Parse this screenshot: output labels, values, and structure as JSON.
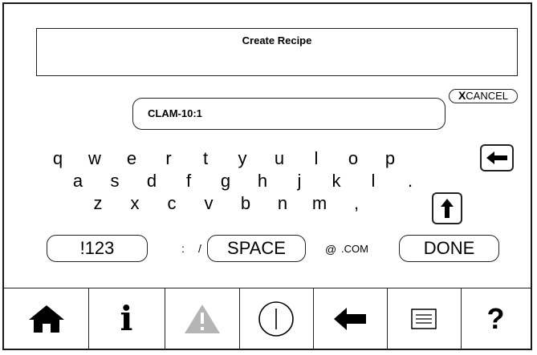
{
  "header": {
    "title": "Create Recipe"
  },
  "cancel_button": {
    "x_label": "X",
    "label": "CANCEL"
  },
  "input": {
    "value": "CLAM-10:1"
  },
  "keyboard": {
    "row1": [
      "q",
      "w",
      "e",
      "r",
      "t",
      "y",
      "u",
      "l",
      "o",
      "p"
    ],
    "row2": [
      "a",
      "s",
      "d",
      "f",
      "g",
      "h",
      "j",
      "k",
      "l",
      "."
    ],
    "row3": [
      "z",
      "x",
      "c",
      "v",
      "b",
      "n",
      "m",
      ","
    ],
    "symbols_label": "!123",
    "colon_label": ":",
    "slash_label": "/",
    "space_label": "SPACE",
    "at_label": "@",
    "com_label": ".COM",
    "done_label": "DONE"
  },
  "toolbar": {
    "items": [
      {
        "icon": "home-icon"
      },
      {
        "icon": "info-icon",
        "label": "i"
      },
      {
        "icon": "warning-icon",
        "color": "#b5b5b5"
      },
      {
        "icon": "power-icon"
      },
      {
        "icon": "back-arrow-icon"
      },
      {
        "icon": "menu-list-icon"
      },
      {
        "icon": "help-icon",
        "label": "?"
      }
    ]
  }
}
